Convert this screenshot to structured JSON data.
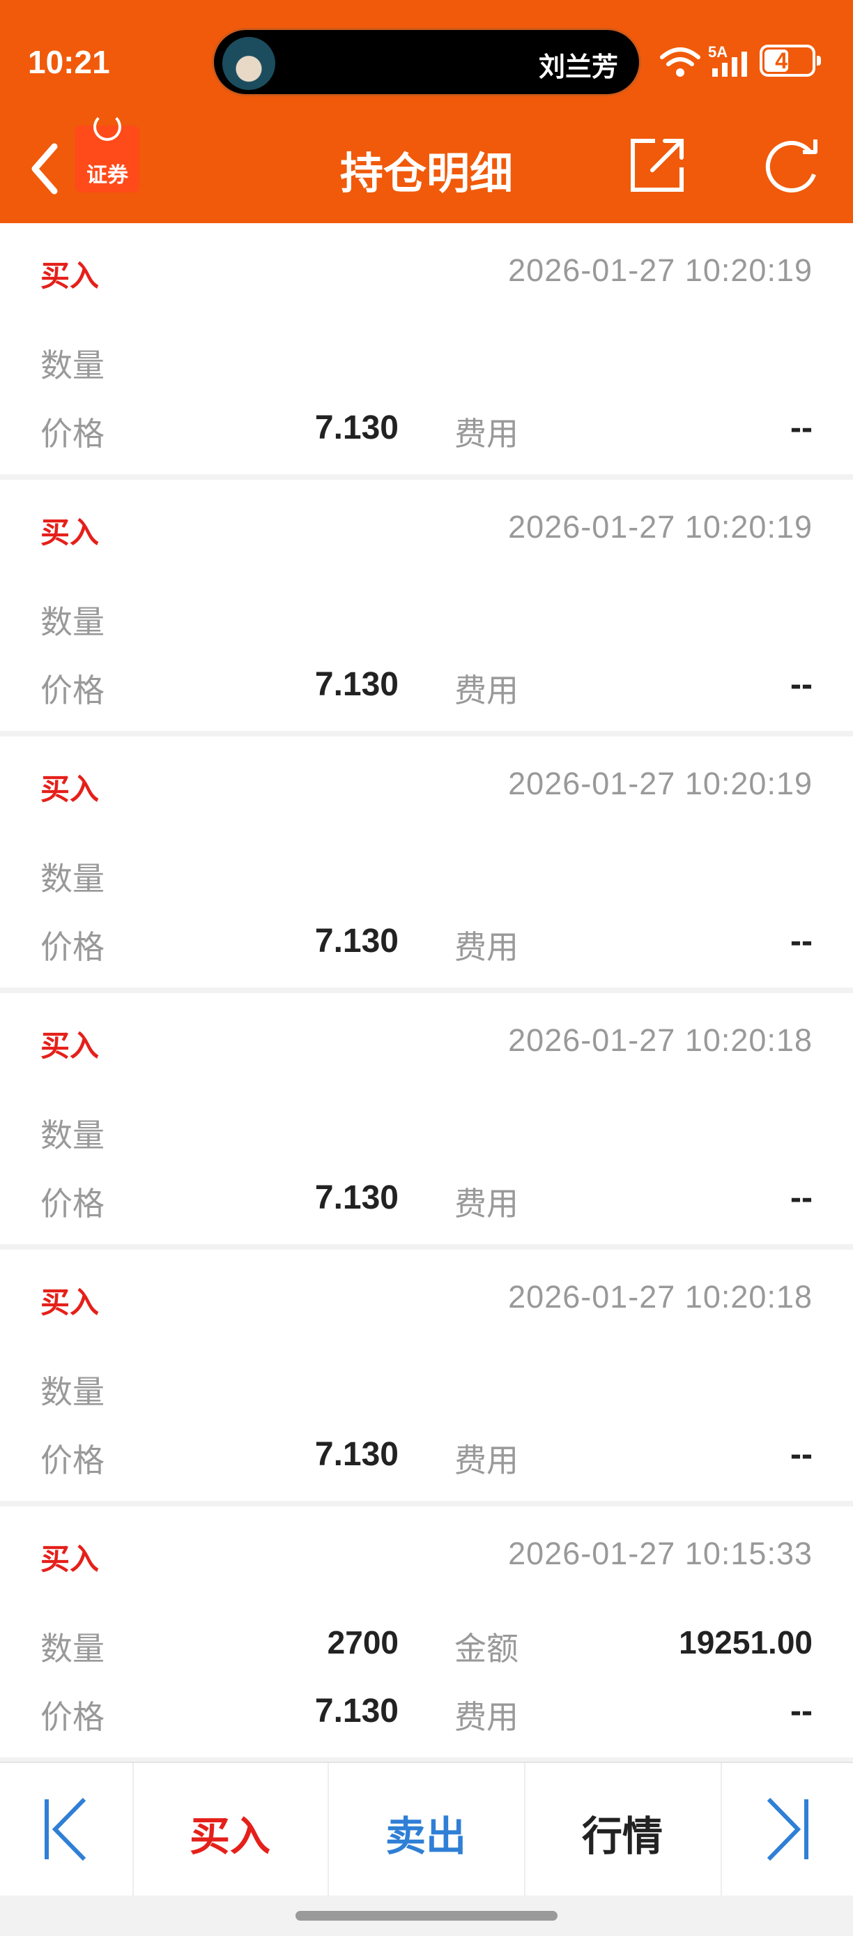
{
  "status_bar": {
    "time": "10:21",
    "island_name": "刘兰芳",
    "network": "5A",
    "battery": "47"
  },
  "nav": {
    "logo_text": "证券",
    "title": "持仓明细"
  },
  "labels": {
    "quantity": "数量",
    "price": "价格",
    "amount": "金额",
    "fee": "费用"
  },
  "records": [
    {
      "type": "买入",
      "time": "2026-01-27 10:20:19",
      "quantity": "",
      "amount": "",
      "price": "7.130",
      "fee": "--"
    },
    {
      "type": "买入",
      "time": "2026-01-27 10:20:19",
      "quantity": "",
      "amount": "",
      "price": "7.130",
      "fee": "--"
    },
    {
      "type": "买入",
      "time": "2026-01-27 10:20:19",
      "quantity": "",
      "amount": "",
      "price": "7.130",
      "fee": "--"
    },
    {
      "type": "买入",
      "time": "2026-01-27 10:20:18",
      "quantity": "",
      "amount": "",
      "price": "7.130",
      "fee": "--"
    },
    {
      "type": "买入",
      "time": "2026-01-27 10:20:18",
      "quantity": "",
      "amount": "",
      "price": "7.130",
      "fee": "--"
    },
    {
      "type": "买入",
      "time": "2026-01-27 10:15:33",
      "quantity": "2700",
      "amount": "19251.00",
      "price": "7.130",
      "fee": "--"
    }
  ],
  "toolbar": {
    "buy": "买入",
    "sell": "卖出",
    "quote": "行情"
  },
  "colors": {
    "brand": "#f05a0a",
    "buy": "#e5201a",
    "sell": "#2f7fd6",
    "muted": "#999999"
  },
  "icons": [
    "back-icon",
    "share-icon",
    "refresh-icon",
    "first-page-icon",
    "last-page-icon",
    "wifi-icon",
    "signal-icon",
    "battery-icon"
  ]
}
